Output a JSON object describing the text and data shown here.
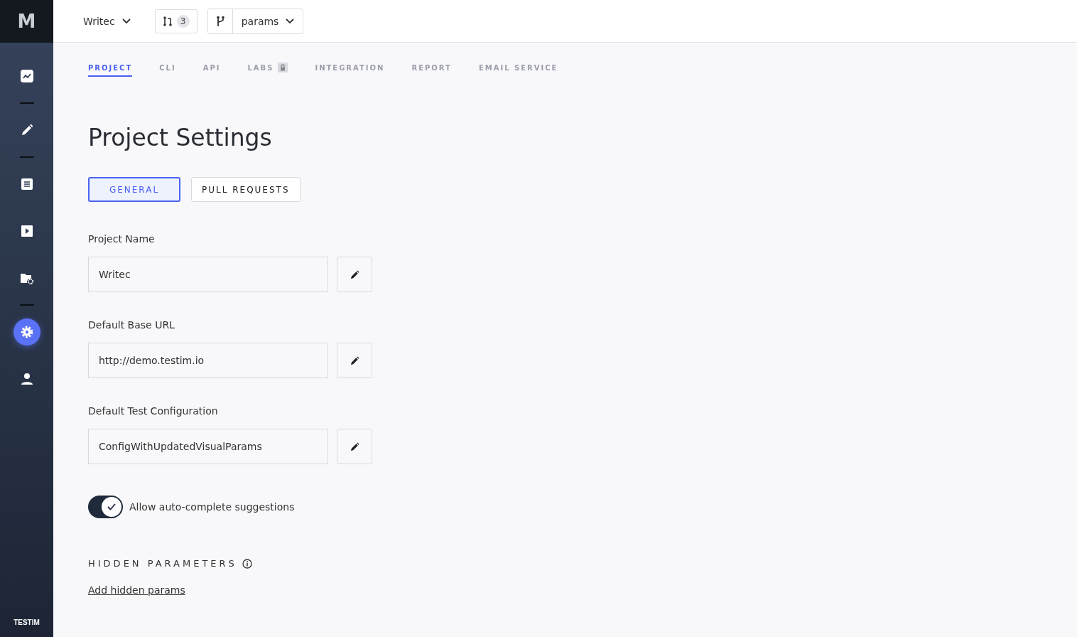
{
  "sidebar": {
    "logo": "M",
    "items": [
      {
        "kind": "chart",
        "selected": false
      },
      {
        "kind": "divider"
      },
      {
        "kind": "pencil",
        "selected": false
      },
      {
        "kind": "divider"
      },
      {
        "kind": "list",
        "selected": false
      },
      {
        "kind": "play",
        "selected": false
      },
      {
        "kind": "folder",
        "selected": false
      },
      {
        "kind": "divider"
      },
      {
        "kind": "gear",
        "selected": true
      },
      {
        "kind": "user",
        "selected": false
      }
    ],
    "brand": "TESTIM"
  },
  "topbar": {
    "project": "Writec",
    "pull_requests_count": "3",
    "branch": "params"
  },
  "tabs": [
    {
      "label": "PROJECT",
      "selected": true,
      "locked": false
    },
    {
      "label": "CLI",
      "selected": false,
      "locked": false
    },
    {
      "label": "API",
      "selected": false,
      "locked": false
    },
    {
      "label": "LABS",
      "selected": false,
      "locked": true
    },
    {
      "label": "INTEGRATION",
      "selected": false,
      "locked": false
    },
    {
      "label": "REPORT",
      "selected": false,
      "locked": false
    },
    {
      "label": "EMAIL SERVICE",
      "selected": false,
      "locked": false
    }
  ],
  "title": "Project Settings",
  "subtabs": [
    {
      "label": "GENERAL",
      "selected": true
    },
    {
      "label": "PULL REQUESTS",
      "selected": false
    }
  ],
  "fields": [
    {
      "label": "Project Name",
      "value": "Writec"
    },
    {
      "label": "Default Base URL",
      "value": "http://demo.testim.io"
    },
    {
      "label": "Default Test Configuration",
      "value": "ConfigWithUpdatedVisualParams"
    }
  ],
  "autocomplete": {
    "label": "Allow auto-complete suggestions",
    "on": true
  },
  "hidden_parameters": {
    "title": "HIDDEN PARAMETERS",
    "link": "Add hidden params"
  }
}
